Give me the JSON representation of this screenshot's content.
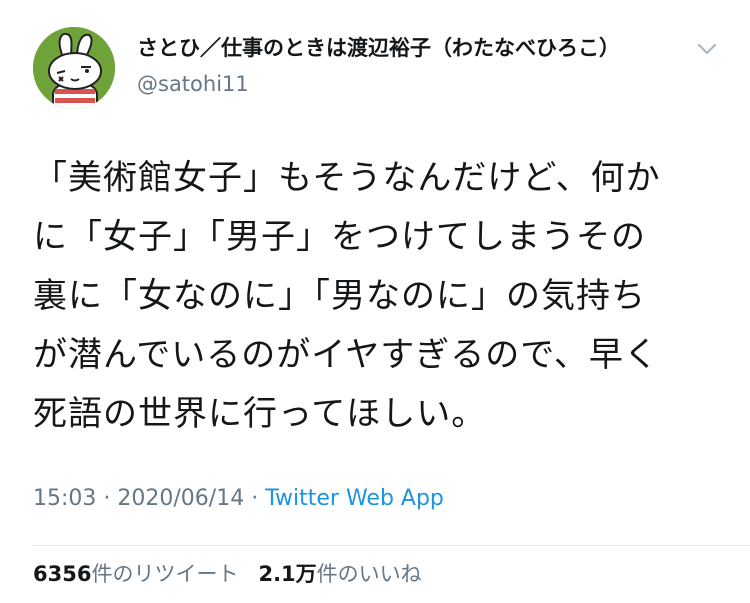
{
  "user": {
    "display_name": "さとひ／仕事のときは渡辺裕子（わたなべひろこ）",
    "handle": "@satohi11",
    "avatar_icon": "rabbit-cartoon-avatar"
  },
  "tweet": {
    "lines": [
      "「美術館女子」もそうなんだけど、何か",
      "に「女子」「男子」をつけてしまうその",
      "裏に「女なのに」「男なのに」の気持ち",
      "が潜んでいるのがイヤすぎるので、早く",
      "死語の世界に行ってほしい。"
    ]
  },
  "meta": {
    "time": "15:03",
    "separator1": "·",
    "date": "2020/06/14",
    "separator2": "·",
    "source": "Twitter Web App"
  },
  "stats": {
    "retweets_count": "6356",
    "retweets_label": "件のリツイート",
    "likes_count": "2.1万",
    "likes_label": "件のいいね"
  },
  "colors": {
    "text": "#14171a",
    "secondary": "#657786",
    "link": "#1b95e0",
    "avatar_bg": "#6fa33a"
  }
}
